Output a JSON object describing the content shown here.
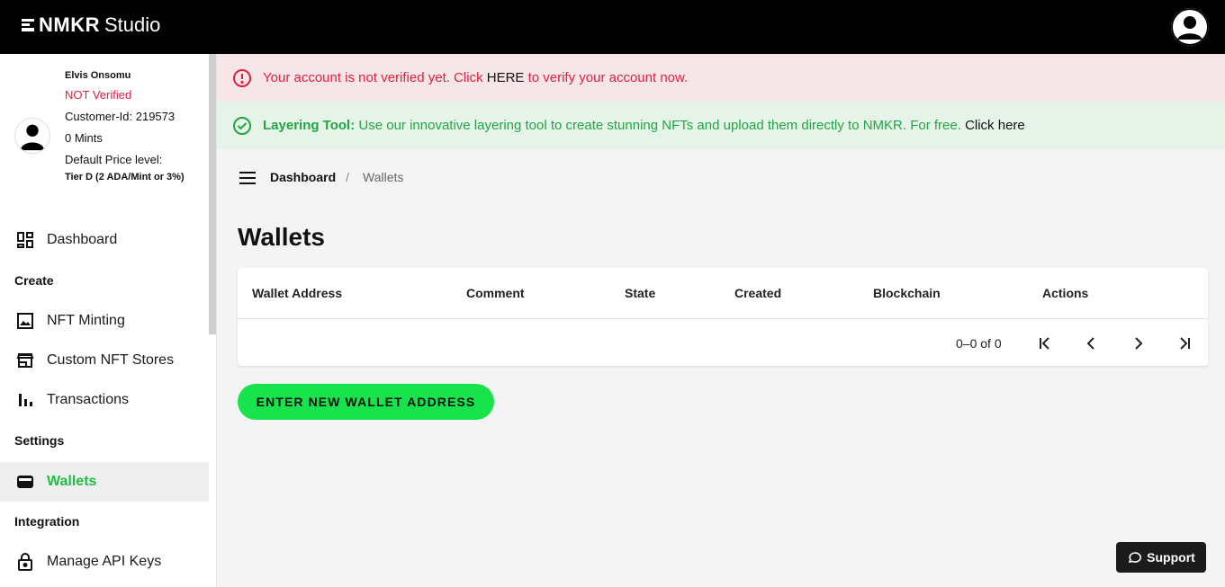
{
  "header": {
    "brand": "NMKR",
    "product": "Studio"
  },
  "profile": {
    "name": "Elvis Onsomu",
    "verification": "NOT Verified",
    "customer_id": "Customer-Id: 219573",
    "mints": "0 Mints",
    "price_level_label": "Default Price level:",
    "price_level_value": "Tier D (2 ADA/Mint or 3%)"
  },
  "sidebar": {
    "dashboard": "Dashboard",
    "section_create": "Create",
    "nft_minting": "NFT Minting",
    "custom_stores": "Custom NFT Stores",
    "transactions": "Transactions",
    "section_settings": "Settings",
    "wallets": "Wallets",
    "section_integration": "Integration",
    "api_keys": "Manage API Keys"
  },
  "alerts": {
    "error_text_before": "Your account is not verified yet. Click ",
    "error_link": "HERE",
    "error_text_after": " to verify your account now.",
    "success_title": "Layering Tool:",
    "success_text": " Use our innovative layering tool to create stunning NFTs and upload them directly to NMKR. For free. ",
    "success_link": "Click here"
  },
  "breadcrumb": {
    "home": "Dashboard",
    "separator": "/",
    "current": "Wallets"
  },
  "page": {
    "title": "Wallets"
  },
  "table": {
    "columns": [
      "Wallet Address",
      "Comment",
      "State",
      "Created",
      "Blockchain",
      "Actions"
    ],
    "rows": [],
    "pagination": "0–0 of 0"
  },
  "actions": {
    "enter_wallet": "ENTER NEW WALLET ADDRESS",
    "support": "Support"
  },
  "colors": {
    "accent_green": "#19e34c",
    "error_red": "#e0203f",
    "success_green": "#22a645"
  }
}
